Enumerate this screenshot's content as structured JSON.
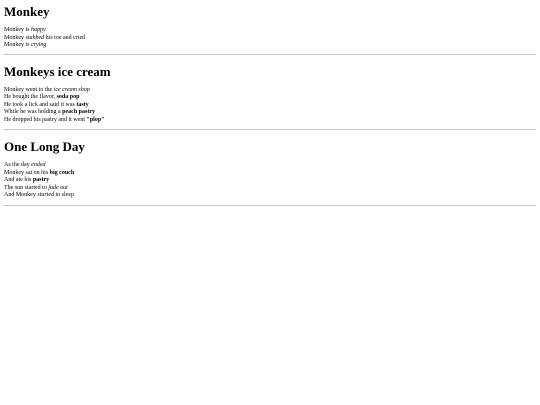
{
  "sections": [
    {
      "title": "Monkey",
      "lines": [
        {
          "a": "Monkey is ",
          "em": "happy",
          "b": ""
        },
        {
          "a": "Monkey ",
          "em": "stubbed",
          "b": " his toe and cried"
        },
        {
          "a": "Monkey is ",
          "em": "crying",
          "b": ""
        }
      ]
    },
    {
      "title": "Monkeys ice cream",
      "lines": [
        {
          "a": "Monkey went to the ",
          "em": "ice cream shop",
          "b": ""
        },
        {
          "a": "He bought the flavor, ",
          "strong": "soda pop",
          "b": ""
        },
        {
          "a": "He took a lick and said it was ",
          "strong": "tasty",
          "b": ""
        },
        {
          "a": "While he was holding a ",
          "strong": "peach pastry",
          "b": ""
        },
        {
          "a": "He dropped his pastry and it went ",
          "strong": "\"plop\"",
          "b": ""
        }
      ]
    },
    {
      "title": "One Long Day",
      "lines": [
        {
          "a": "As the day ",
          "em": "ended",
          "b": ""
        },
        {
          "a": "Monkey sat on his ",
          "strong": "big couch",
          "b": ""
        },
        {
          "a": "And ate his ",
          "strong": "pastry",
          "b": ""
        },
        {
          "a": "The sun started to ",
          "em": "fade out",
          "b": ""
        },
        {
          "a": "And Monkey ",
          "em": "started",
          "b": " to sleep"
        }
      ]
    }
  ]
}
